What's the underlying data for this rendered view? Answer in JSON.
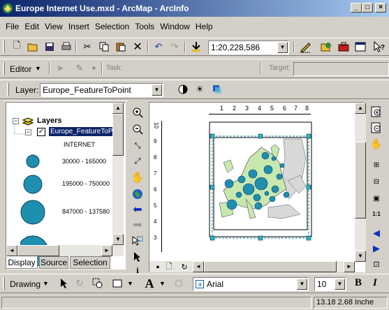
{
  "window": {
    "title": "Europe Internet Use.mxd - ArcMap - ArcInfo"
  },
  "menu": [
    "File",
    "Edit",
    "View",
    "Insert",
    "Selection",
    "Tools",
    "Window",
    "Help"
  ],
  "standard_toolbar": {
    "scale": "1:20,228,586"
  },
  "editor_toolbar": {
    "editor_label": "Editor",
    "task_label": "Task:",
    "target_label": "Target:"
  },
  "layer_toolbar": {
    "layer_label": "Layer:",
    "layer_value": "Europe_FeatureToPoint"
  },
  "toc": {
    "root_label": "Layers",
    "layer_name": "Europe_FeatureToPo",
    "field_name": "INTERNET",
    "classes": [
      "30000 - 165000",
      "195000 - 750000",
      "847000 - 137580"
    ],
    "tabs": [
      "Display",
      "Source",
      "Selection"
    ]
  },
  "ruler": {
    "ticks": [
      "1",
      "2",
      "3",
      "4",
      "5",
      "6",
      "7",
      "8"
    ],
    "vticks": [
      "10",
      "9",
      "8",
      "7",
      "6",
      "5",
      "4",
      "3"
    ]
  },
  "drawing_toolbar": {
    "drawing_label": "Drawing",
    "font": "Arial",
    "size": "10",
    "bold": "B",
    "italic": "I"
  },
  "status": {
    "coords": "13.18  2.68 Inche"
  },
  "colors": {
    "titlebar_start": "#0a246a",
    "titlebar_end": "#a6caf0",
    "symbol_fill": "#1f8fb0",
    "land_fill": "#c8e8b0"
  }
}
